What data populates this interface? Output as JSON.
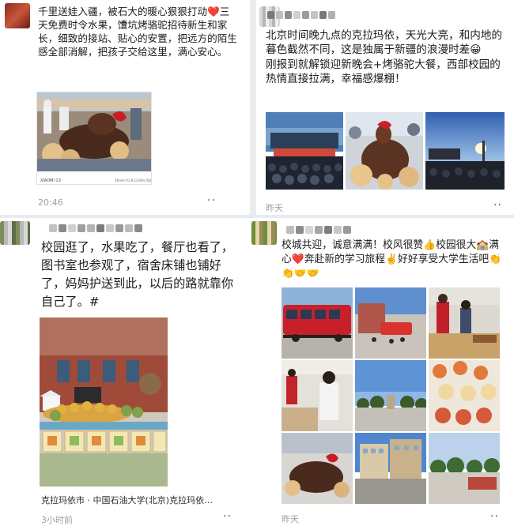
{
  "posts": [
    {
      "text": "千里送娃入疆，被石大的暖心狠狠打动❤️三天免费时令水果，馕坑烤骆驼招待新生和家长，细致的接站、贴心的安置，把远方的陌生感全部消解，把孩子交给这里，满心安心。",
      "time": "20:46",
      "camera": "XIAOMI 13",
      "more": "··"
    },
    {
      "text": "北京时间晚九点的克拉玛依，天光大亮，和内地的暮色截然不同，这是独属于新疆的浪漫时差😀\n刚报到就解锁迎新晚会+烤骆驼大餐，西部校园的热情直接拉满，幸福感爆棚！",
      "time": "昨天",
      "more": "··"
    },
    {
      "text": "校园逛了，水果吃了，餐厅也看了，图书室也参观了，宿舍床铺也铺好了，妈妈护送到此，以后的路就靠你自己了。#",
      "location": "克拉玛依市 · 中国石油大学(北京)克拉玛依…",
      "time": "3小时前",
      "more": "··"
    },
    {
      "text": "校城共迎，诚意满满！校风很赞👍校园很大🏫满心❤️奔赴新的学习旅程✌️好好享受大学生活吧👏👏🤝🤝",
      "time": "昨天",
      "more": "··"
    }
  ],
  "colors": {
    "background": "#e9ecee",
    "card": "#ffffff",
    "text": "#1b1b1b",
    "meta": "#9aa0a6"
  }
}
